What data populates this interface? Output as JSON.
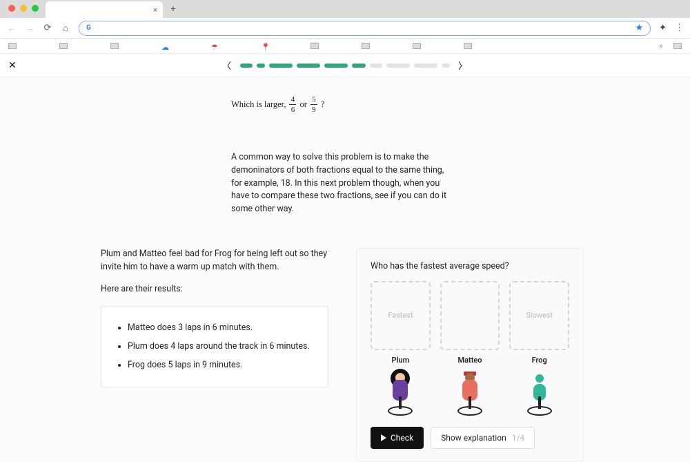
{
  "header": {
    "traffic_colors": [
      "#ff5f57",
      "#ffbd2e",
      "#28c840"
    ]
  },
  "progress": {
    "segments": [
      {
        "w": 18,
        "filled": true
      },
      {
        "w": 12,
        "filled": true
      },
      {
        "w": 34,
        "filled": true
      },
      {
        "w": 34,
        "filled": true
      },
      {
        "w": 34,
        "filled": true
      },
      {
        "w": 20,
        "filled": true
      },
      {
        "w": 18,
        "filled": false
      },
      {
        "w": 34,
        "filled": false
      },
      {
        "w": 34,
        "filled": false
      },
      {
        "w": 12,
        "filled": false
      }
    ]
  },
  "question": {
    "lead": "Which is larger,",
    "frac1_num": "4",
    "frac1_den": "6",
    "or": "or",
    "frac2_num": "5",
    "frac2_den": "9",
    "tail": "?"
  },
  "explain": "A common way to solve this problem is to make the demoninators of both fractions equal to the same thing, for example, 18. In this next problem though, when you have to compare these two fractions, see if you can do it some other way.",
  "left": {
    "intro": "Plum and Matteo feel bad for Frog for being left out so they invite him to have a warm up match with them.",
    "results_label": "Here are their results:",
    "bullets": [
      "Matteo does 3 laps in 6 minutes.",
      "Plum does 4 laps around the track in 6 minutes.",
      "Frog does 5 laps in 9 minutes."
    ]
  },
  "card": {
    "prompt": "Who has the fastest average speed?",
    "slot_labels": [
      "Fastest",
      "",
      "Slowest"
    ],
    "characters": [
      "Plum",
      "Matteo",
      "Frog"
    ],
    "check_label": "Check",
    "show_label": "Show explanation",
    "show_count": "1/4"
  }
}
